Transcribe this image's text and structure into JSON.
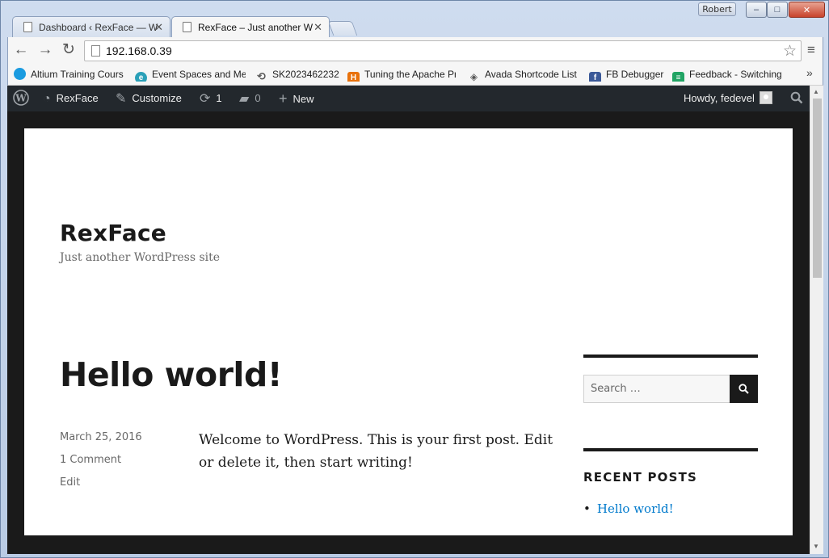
{
  "window": {
    "user_badge": "Robert",
    "minimize": "–",
    "maximize": "□",
    "close": "✕"
  },
  "tabs": [
    {
      "title": "Dashboard ‹ RexFace — W",
      "active": false
    },
    {
      "title": "RexFace – Just another W",
      "active": true
    }
  ],
  "toolbar": {
    "back_icon": "←",
    "forward_icon": "→",
    "reload_icon": "↻",
    "url": "192.168.0.39",
    "star_icon": "☆",
    "menu_icon": "≡"
  },
  "bookmarks": {
    "items": [
      {
        "label": "Altium Training Cours",
        "icon": "cloud-icon",
        "color": "#1a9be0"
      },
      {
        "label": "Event Spaces and Me",
        "icon": "e-icon",
        "color": "#2aa0b8"
      },
      {
        "label": "SK2023462232",
        "icon": "history-icon",
        "color": "#555555"
      },
      {
        "label": "Tuning the Apache Pr",
        "icon": "h-icon",
        "color": "#e8720c"
      },
      {
        "label": "Avada Shortcode List",
        "icon": "avada-icon",
        "color": "#555555"
      },
      {
        "label": "FB Debugger",
        "icon": "facebook-icon",
        "color": "#3b5998"
      },
      {
        "label": "Feedback - Switching",
        "icon": "sheets-icon",
        "color": "#21a464"
      }
    ],
    "more": "»"
  },
  "adminbar": {
    "site_name": "RexFace",
    "customize": "Customize",
    "updates_count": "1",
    "comments_count": "0",
    "new_label": "New",
    "howdy": "Howdy, fedevel"
  },
  "site": {
    "title": "RexFace",
    "description": "Just another WordPress site"
  },
  "post": {
    "title": "Hello world!",
    "date": "March 25, 2016",
    "comments": "1 Comment",
    "edit": "Edit",
    "body": "Welcome to WordPress. This is your first post. Edit or delete it, then start writing!"
  },
  "sidebar": {
    "search_placeholder": "Search …",
    "recent_title": "RECENT POSTS",
    "recent_posts": [
      "Hello world!"
    ]
  }
}
